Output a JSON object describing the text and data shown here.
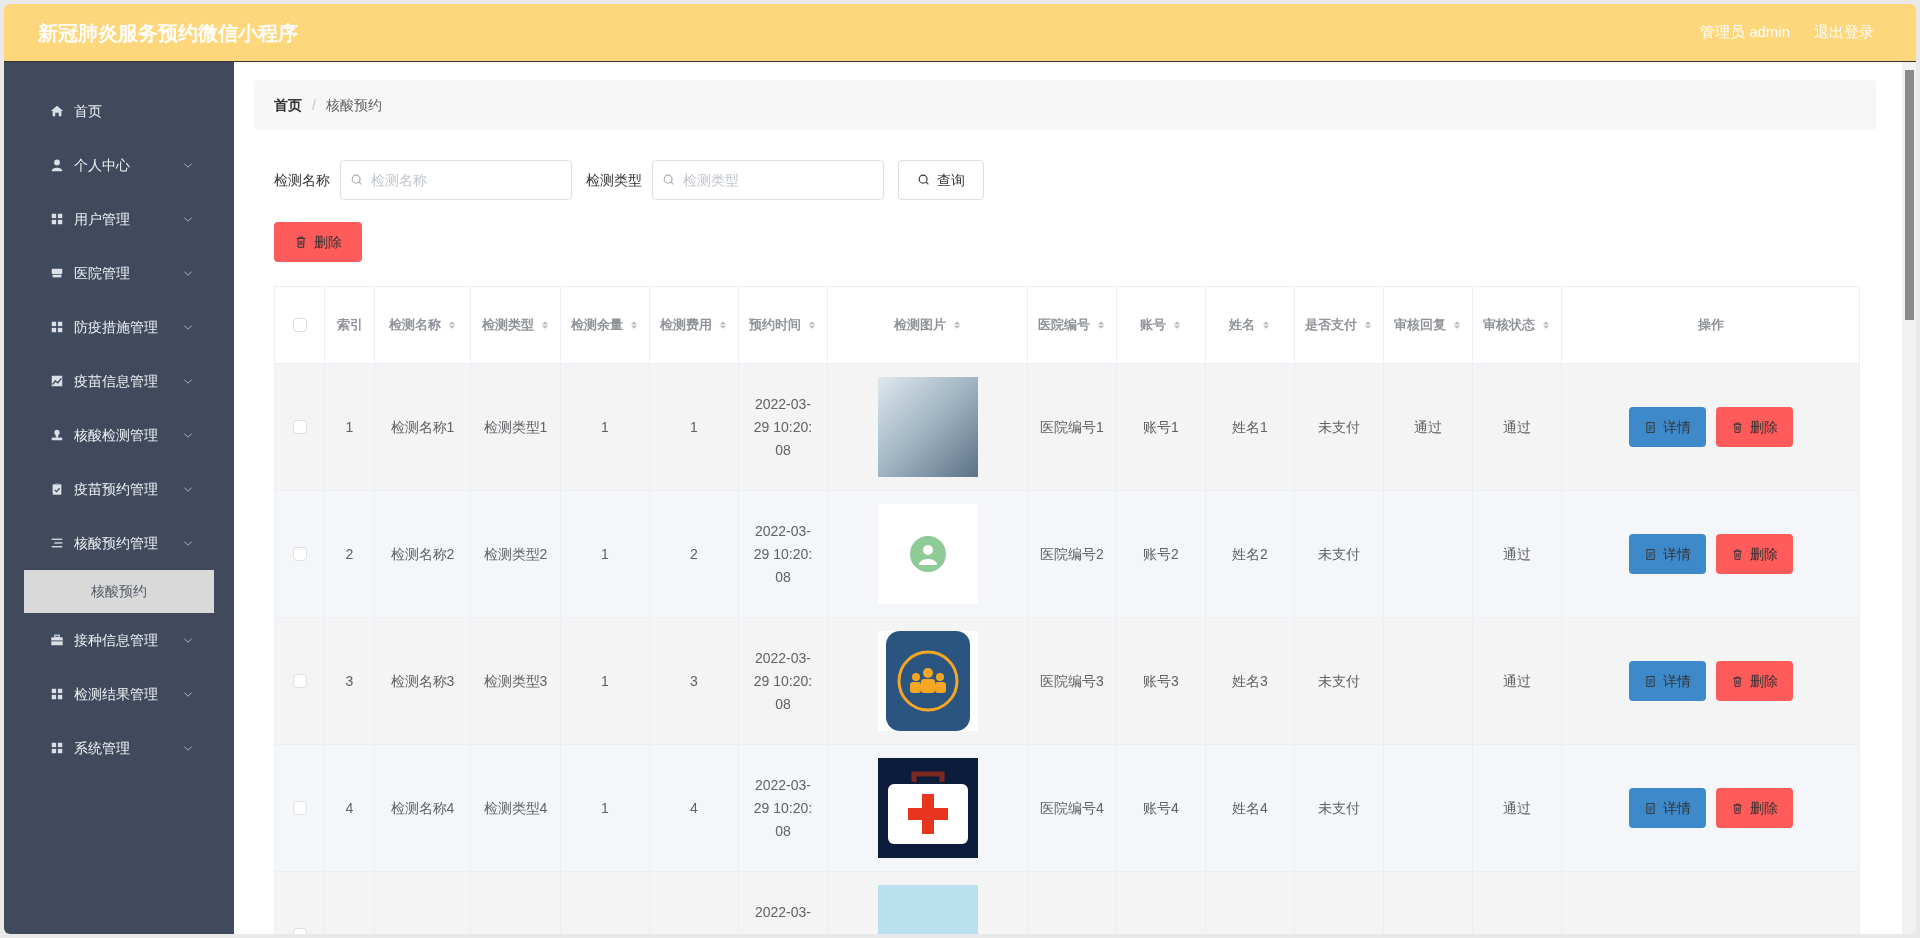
{
  "header": {
    "title": "新冠肺炎服务预约微信小程序",
    "user": "管理员 admin",
    "logout": "退出登录"
  },
  "sidebar": {
    "items": [
      {
        "label": "首页",
        "kind": "link"
      },
      {
        "label": "个人中心",
        "kind": "menu"
      },
      {
        "label": "用户管理",
        "kind": "menu"
      },
      {
        "label": "医院管理",
        "kind": "menu"
      },
      {
        "label": "防疫措施管理",
        "kind": "menu"
      },
      {
        "label": "疫苗信息管理",
        "kind": "menu"
      },
      {
        "label": "核酸检测管理",
        "kind": "menu"
      },
      {
        "label": "疫苗预约管理",
        "kind": "menu"
      },
      {
        "label": "核酸预约管理",
        "kind": "menu",
        "children": [
          {
            "label": "核酸预约",
            "selected": true
          }
        ]
      },
      {
        "label": "接种信息管理",
        "kind": "menu"
      },
      {
        "label": "检测结果管理",
        "kind": "menu"
      },
      {
        "label": "系统管理",
        "kind": "menu"
      }
    ]
  },
  "breadcrumb": {
    "items": [
      {
        "label": "首页"
      },
      {
        "label": "核酸预约"
      }
    ],
    "separator": "/"
  },
  "search": {
    "fields": [
      {
        "label": "检测名称",
        "placeholder": "检测名称"
      },
      {
        "label": "检测类型",
        "placeholder": "检测类型"
      }
    ],
    "button": "查询"
  },
  "delete_button": "删除",
  "table": {
    "select_all_checked": false,
    "columns": [
      {
        "label": "索引",
        "kind": "plain"
      },
      {
        "label": "检测名称",
        "kind": "sort"
      },
      {
        "label": "检测类型",
        "kind": "sort"
      },
      {
        "label": "检测余量",
        "kind": "sort"
      },
      {
        "label": "检测费用",
        "kind": "sort"
      },
      {
        "label": "预约时间",
        "kind": "sort"
      },
      {
        "label": "检测图片",
        "kind": "sort"
      },
      {
        "label": "医院编号",
        "kind": "sort"
      },
      {
        "label": "账号",
        "kind": "sort"
      },
      {
        "label": "姓名",
        "kind": "sort"
      },
      {
        "label": "是否支付",
        "kind": "sort"
      },
      {
        "label": "审核回复",
        "kind": "sort"
      },
      {
        "label": "审核状态",
        "kind": "sort"
      },
      {
        "label": "操作",
        "kind": "plain"
      }
    ],
    "rows": [
      {
        "checked": false,
        "cells": [
          "1",
          "检测名称1",
          "检测类型1",
          "1",
          "1",
          "2022-03-29 10:20:08",
          "",
          "医院编号1",
          "账号1",
          "姓名1",
          "未支付",
          "通过",
          "通过"
        ],
        "actions": [
          "详情",
          "删除"
        ]
      },
      {
        "checked": false,
        "cells": [
          "2",
          "检测名称2",
          "检测类型2",
          "1",
          "2",
          "2022-03-29 10:20:08",
          "",
          "医院编号2",
          "账号2",
          "姓名2",
          "未支付",
          "",
          "通过"
        ],
        "actions": [
          "详情",
          "删除"
        ]
      },
      {
        "checked": false,
        "cells": [
          "3",
          "检测名称3",
          "检测类型3",
          "1",
          "3",
          "2022-03-29 10:20:08",
          "",
          "医院编号3",
          "账号3",
          "姓名3",
          "未支付",
          "",
          "通过"
        ],
        "actions": [
          "详情",
          "删除"
        ]
      },
      {
        "checked": false,
        "cells": [
          "4",
          "检测名称4",
          "检测类型4",
          "1",
          "4",
          "2022-03-29 10:20:08",
          "",
          "医院编号4",
          "账号4",
          "姓名4",
          "未支付",
          "",
          "通过"
        ],
        "actions": [
          "详情",
          "删除"
        ]
      },
      {
        "checked": false,
        "cells": [
          "",
          "",
          "",
          "",
          "",
          "2022-03-",
          "",
          "",
          "",
          "",
          "",
          "",
          ""
        ],
        "actions": []
      }
    ]
  }
}
